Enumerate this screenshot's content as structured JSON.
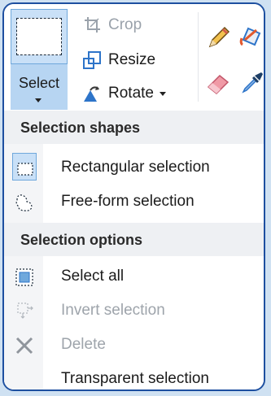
{
  "ribbon": {
    "select_label": "Select",
    "crop_label": "Crop",
    "resize_label": "Resize",
    "rotate_label": "Rotate",
    "tools": [
      "pencil-icon",
      "fill-bucket-icon",
      "eraser-icon",
      "color-picker-icon"
    ]
  },
  "menu": {
    "selection_shapes_header": "Selection shapes",
    "rectangular_label": "Rectangular selection",
    "freeform_label": "Free-form selection",
    "selection_options_header": "Selection options",
    "select_all_label": "Select all",
    "invert_label": "Invert selection",
    "delete_label": "Delete",
    "transparent_label": "Transparent selection"
  },
  "colors": {
    "frame_border": "#1d4fa0",
    "select_highlight": "#c9e0f7",
    "header_bg": "#eef0f3",
    "disabled_text": "#9ea4ab",
    "accent": "#2d74c9"
  }
}
